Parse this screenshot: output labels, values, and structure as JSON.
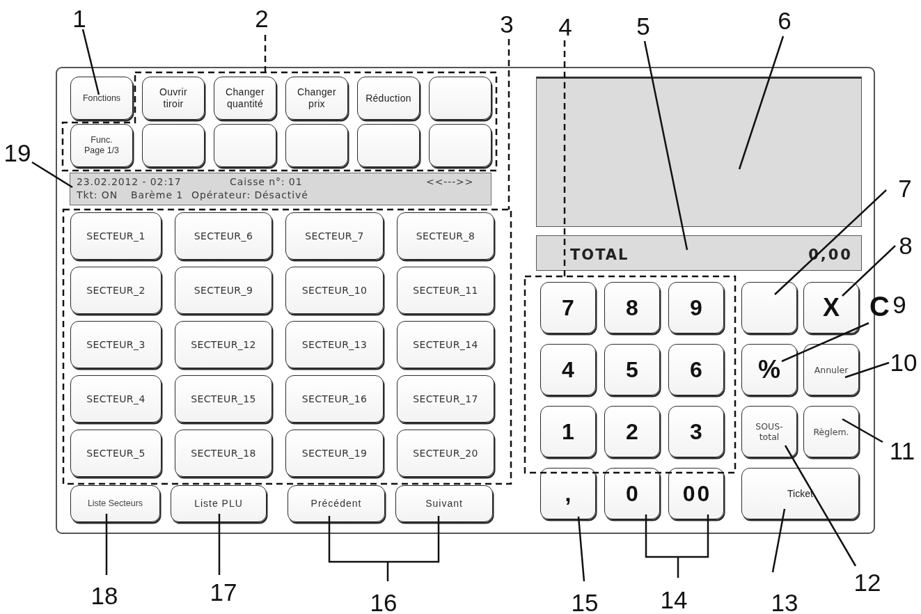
{
  "function_keys": {
    "rows": [
      [
        {
          "kind": "text",
          "label": "Fonctions"
        },
        {
          "kind": "text",
          "label": "Ouvrir tiroir"
        },
        {
          "kind": "text",
          "label": "Changer quantité"
        },
        {
          "kind": "text",
          "label": "Changer prix"
        },
        {
          "kind": "text",
          "label": "Réduction"
        },
        {
          "kind": "blank"
        }
      ],
      [
        {
          "kind": "text",
          "label": "Func. Page 1/3"
        },
        {
          "kind": "blank"
        },
        {
          "kind": "blank"
        },
        {
          "kind": "blank"
        },
        {
          "kind": "blank"
        },
        {
          "kind": "blank"
        }
      ]
    ]
  },
  "status_bar": {
    "date_time": "23.02.2012 - 02:17",
    "register": "Caisse n°: 01",
    "scroll_arrows": "<<--->>",
    "ticket": "Tkt: ON",
    "scale": "Barème 1",
    "operator": "Opérateur: Désactivé"
  },
  "sector_keys": [
    "SECTEUR_1",
    "SECTEUR_6",
    "SECTEUR_7",
    "SECTEUR_8",
    "SECTEUR_2",
    "SECTEUR_9",
    "SECTEUR_10",
    "SECTEUR_11",
    "SECTEUR_3",
    "SECTEUR_12",
    "SECTEUR_13",
    "SECTEUR_14",
    "SECTEUR_4",
    "SECTEUR_15",
    "SECTEUR_16",
    "SECTEUR_17",
    "SECTEUR_5",
    "SECTEUR_18",
    "SECTEUR_19",
    "SECTEUR_20"
  ],
  "bottom_keys": [
    "Liste Secteurs",
    "Liste PLU",
    "Précédent",
    "Suivant"
  ],
  "total": {
    "label": "TOTAL",
    "value": "0,00"
  },
  "keypad": {
    "digit_keys": [
      "7",
      "8",
      "9",
      "4",
      "5",
      "6",
      "1",
      "2",
      "3",
      ",",
      "0",
      "00"
    ],
    "operation_keys": [
      {
        "kind": "blank"
      },
      {
        "kind": "symbol",
        "label": "X"
      },
      {
        "kind": "symbol",
        "label": "%"
      },
      {
        "kind": "text",
        "label": "Annuler"
      },
      {
        "kind": "text",
        "label": "SOUS-total"
      },
      {
        "kind": "text",
        "label": "Règlem."
      },
      {
        "kind": "wide",
        "label": "Ticket"
      }
    ]
  },
  "stray_letter": "C",
  "callouts": [
    "1",
    "2",
    "3",
    "4",
    "5",
    "6",
    "19",
    "7",
    "8",
    "9",
    "10",
    "11",
    "18",
    "17",
    "16",
    "15",
    "14",
    "13",
    "12"
  ]
}
